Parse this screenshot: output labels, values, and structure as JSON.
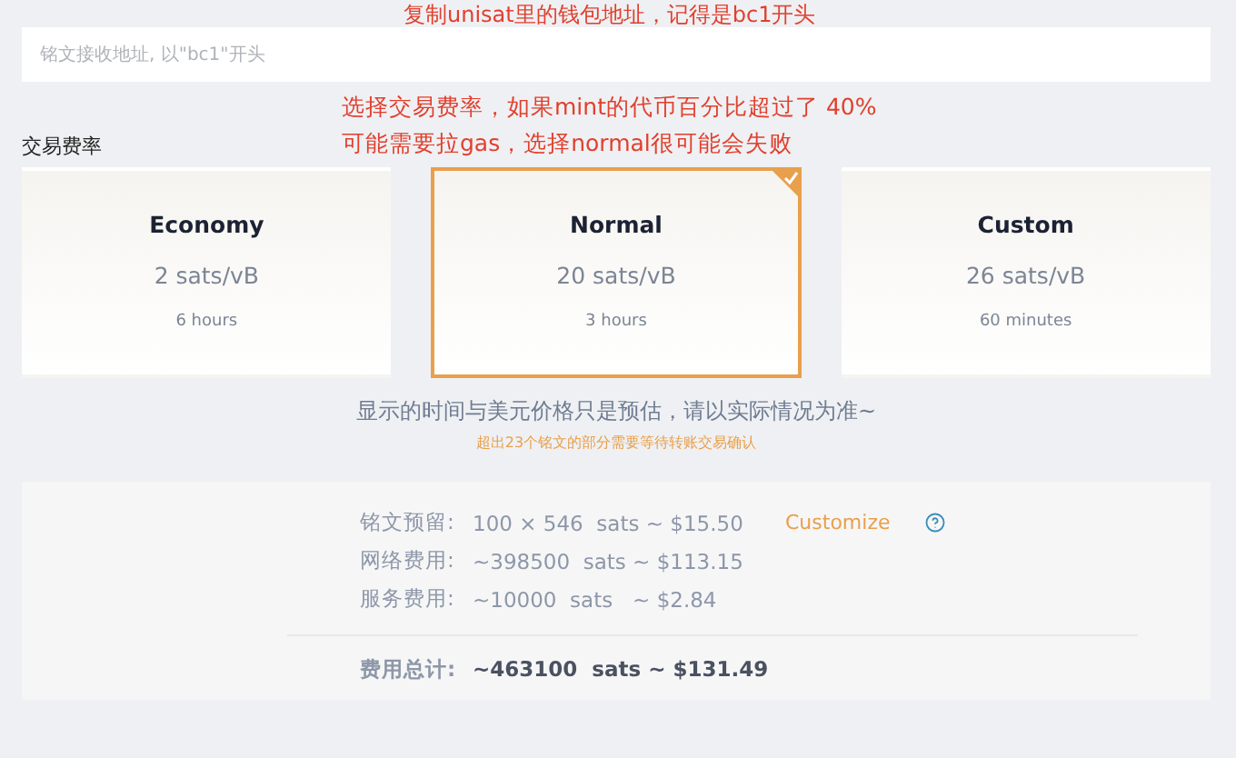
{
  "top_annotation": "复制unisat里的钱包地址，记得是bc1开头",
  "address_field": {
    "placeholder": "铭文接收地址, 以\"bc1\"开头"
  },
  "fee_annotation": [
    "选择交易费率，如果mint的代币百分比超过了 40%",
    "可能需要拉gas，选择normal很可能会失败"
  ],
  "fee_label": "交易费率",
  "fee_options": [
    {
      "name": "Economy",
      "rate": "2 sats/vB",
      "time": "6 hours",
      "selected": false
    },
    {
      "name": "Normal",
      "rate": "20 sats/vB",
      "time": "3 hours",
      "selected": true
    },
    {
      "name": "Custom",
      "rate": "26 sats/vB",
      "time": "60 minutes",
      "selected": false
    }
  ],
  "estimate_note": "显示的时间与美元价格只是预估，请以实际情况为准~",
  "warning_note": "超出23个铭文的部分需要等待转账交易确认",
  "summary": {
    "rows": [
      {
        "label": "铭文预留:",
        "value": "100 × 546  sats ~ $15.50",
        "action": "Customize"
      },
      {
        "label": "网络费用:",
        "value": "~398500  sats ~ $113.15"
      },
      {
        "label": "服务费用:",
        "value": "~10000  sats   ~ $2.84"
      }
    ],
    "total": {
      "label": "费用总计:",
      "value": "~463100  sats ~ $131.49"
    }
  }
}
